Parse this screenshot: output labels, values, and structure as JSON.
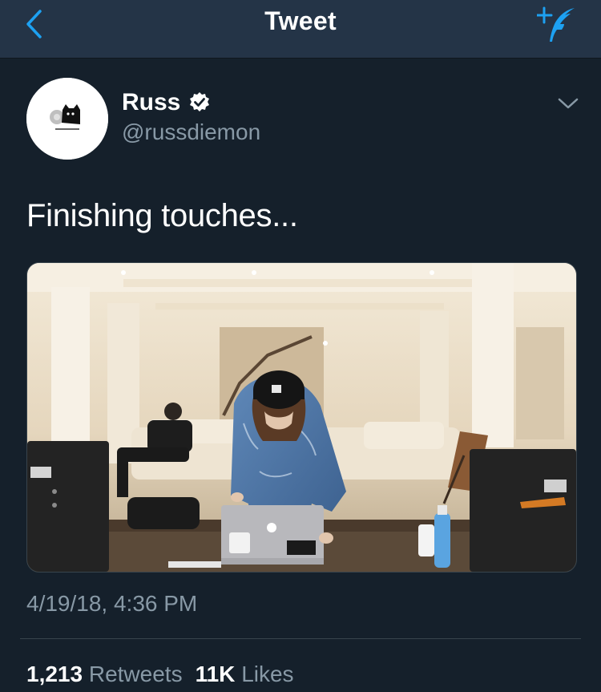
{
  "nav": {
    "title": "Tweet"
  },
  "icons": {
    "back": "chevron-left-icon",
    "compose": "compose-tweet-icon",
    "verified": "verified-badge-icon",
    "caret": "chevron-down-icon"
  },
  "tweet": {
    "display_name": "Russ",
    "handle": "@russdiemon",
    "text": "Finishing touches...",
    "timestamp": "4/19/18, 4:36 PM",
    "retweets_count": "1,213",
    "retweets_label": "Retweets",
    "likes_count": "11K",
    "likes_label": "Likes"
  },
  "colors": {
    "accent": "#1da1f2",
    "background": "#15202b",
    "navbar": "#243447",
    "secondary_text": "#8899a6"
  }
}
